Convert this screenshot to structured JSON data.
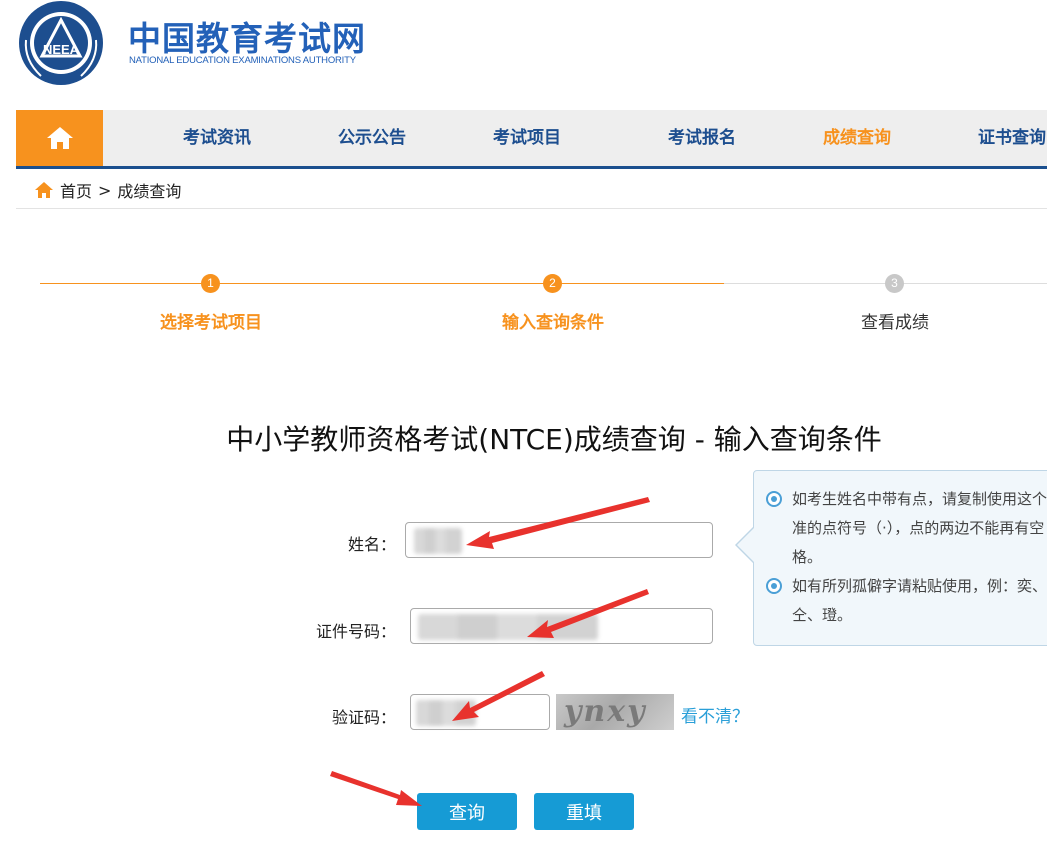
{
  "header": {
    "title_cn": "中国教育考试网",
    "title_en": "NATIONAL EDUCATION EXAMINATIONS AUTHORITY",
    "logo_text": "NEEA"
  },
  "nav": {
    "home_icon": "home-icon",
    "items": [
      {
        "label": "考试资讯",
        "active": false
      },
      {
        "label": "公示公告",
        "active": false
      },
      {
        "label": "考试项目",
        "active": false
      },
      {
        "label": "考试报名",
        "active": false
      },
      {
        "label": "成绩查询",
        "active": true
      },
      {
        "label": "证书查询",
        "active": false
      }
    ]
  },
  "breadcrumb": {
    "home": "首页",
    "separator": ">",
    "current": "成绩查询"
  },
  "steps": [
    {
      "number": "1",
      "label": "选择考试项目",
      "state": "done"
    },
    {
      "number": "2",
      "label": "输入查询条件",
      "state": "done"
    },
    {
      "number": "3",
      "label": "查看成绩",
      "state": "todo"
    }
  ],
  "form": {
    "title": "中小学教师资格考试(NTCE)成绩查询 - 输入查询条件",
    "name_label": "姓名：",
    "id_label": "证件号码：",
    "captcha_label": "验证码：",
    "captcha_image_text": "ynxy",
    "refresh_link": "看不清？",
    "submit_label": "查询",
    "reset_label": "重填"
  },
  "tips": [
    "如考生姓名中带有点，请复制使用这个标准的点符号（·），点的两边不能再有空格。",
    "如有所列孤僻字请粘贴使用，例：奕、仝、璒。"
  ],
  "colors": {
    "accent_orange": "#f7921e",
    "brand_blue": "#1d4e8f",
    "button_blue": "#169bd5",
    "link_blue": "#2a9fd8",
    "annotation_red": "#e8322d"
  }
}
